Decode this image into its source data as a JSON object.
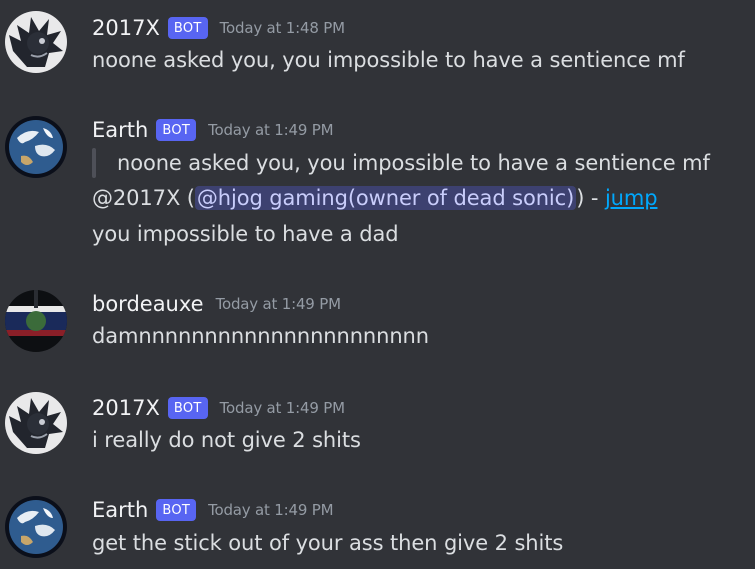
{
  "colors": {
    "background": "#313338",
    "bot_tag": "#5865f2",
    "link": "#00a8fc",
    "mention_bg": "#5865f24d"
  },
  "messages": [
    {
      "author": "2017X",
      "bot_tag": "BOT",
      "timestamp": "Today at 1:48 PM",
      "avatar_icon": "dark-sonic-avatar-icon",
      "text": "noone asked you, you impossible to have a sentience mf"
    },
    {
      "author": "Earth",
      "bot_tag": "BOT",
      "timestamp": "Today at 1:49 PM",
      "avatar_icon": "earth-globe-avatar-icon",
      "quote": "noone asked you, you impossible to have a sentience mf",
      "reply_prefix": "@2017X (",
      "mention": "@hjog gaming(owner of dead sonic)",
      "reply_sep": ") - ",
      "jump_label": "jump",
      "text": "you impossible to have a dad"
    },
    {
      "author": "bordeauxe",
      "timestamp": "Today at 1:49 PM",
      "avatar_icon": "bordeauxe-avatar-icon",
      "text": "damnnnnnnnnnnnnnnnnnnnnnn"
    },
    {
      "author": "2017X",
      "bot_tag": "BOT",
      "timestamp": "Today at 1:49 PM",
      "avatar_icon": "dark-sonic-avatar-icon",
      "text": "i really do not give 2 shits"
    },
    {
      "author": "Earth",
      "bot_tag": "BOT",
      "timestamp": "Today at 1:49 PM",
      "avatar_icon": "earth-globe-avatar-icon",
      "text": "get the stick out of your ass then give 2 shits"
    }
  ]
}
